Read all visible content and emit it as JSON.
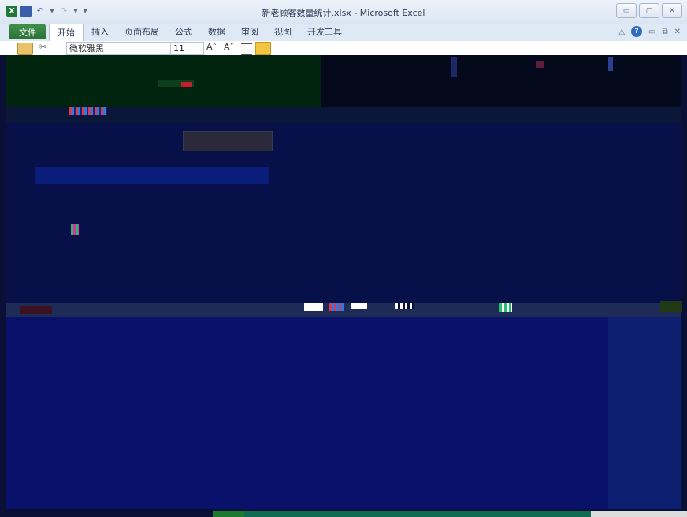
{
  "window": {
    "title": "新老顾客数量统计.xlsx - Microsoft Excel",
    "controls": {
      "minimize": "▭",
      "maximize": "▢",
      "close": "✕"
    }
  },
  "quick_access": {
    "app_icon": "excel-logo-icon",
    "app_letter": "X",
    "save_icon": "save-icon",
    "undo_icon": "undo-icon",
    "redo_icon": "redo-icon",
    "customize_icon": "dropdown-icon"
  },
  "tabs": {
    "file": "文件",
    "items": [
      "开始",
      "插入",
      "页面布局",
      "公式",
      "数据",
      "审阅",
      "视图",
      "开发工具"
    ],
    "active_index": 0
  },
  "ribbon": {
    "font_name": "微软雅黑",
    "font_size": "11",
    "paste_icon": "clipboard-icon",
    "cut_icon": "scissors-icon"
  },
  "colors": {
    "file_tab": "#2a7236",
    "title_bar": "#dbe5f2",
    "corrupted_background": "#0a0f35"
  }
}
